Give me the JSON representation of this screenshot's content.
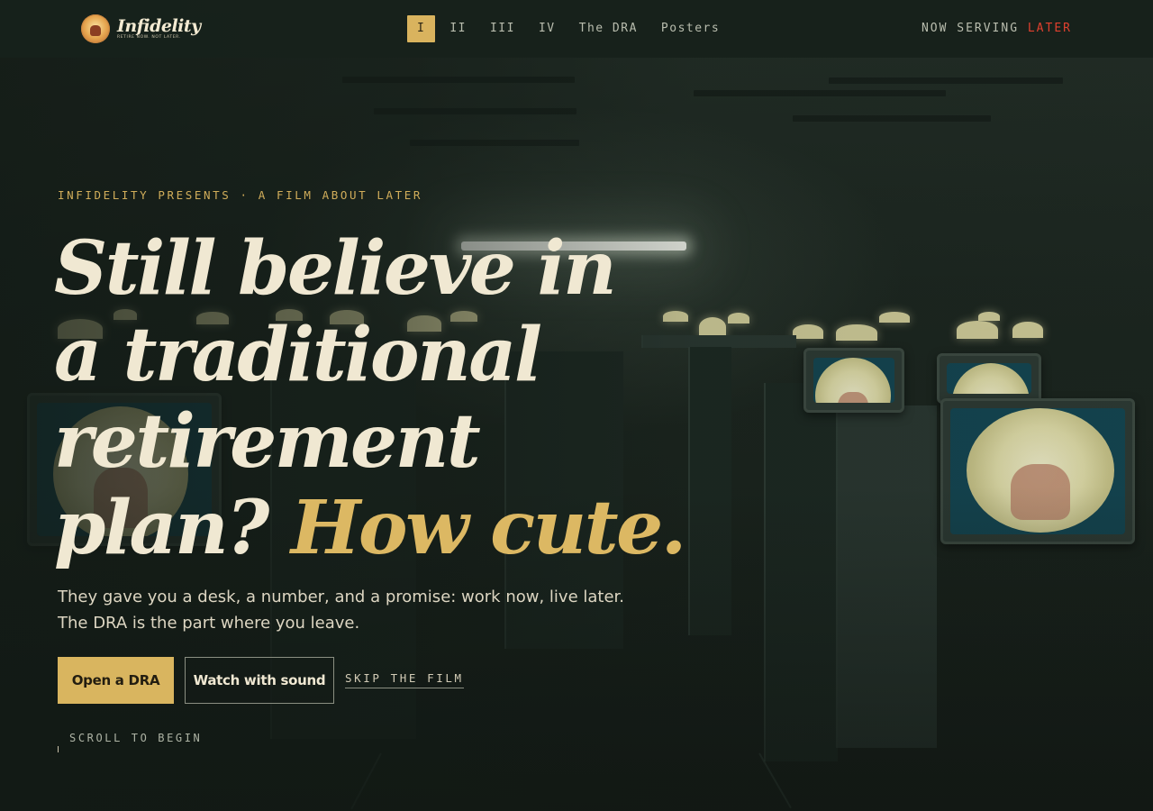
{
  "nav": {
    "brand": {
      "name": "Infidelity",
      "tagline": "RETIRE NOW. NOT LATER."
    },
    "links": [
      {
        "label": "I",
        "active": true
      },
      {
        "label": "II",
        "active": false
      },
      {
        "label": "III",
        "active": false
      },
      {
        "label": "IV",
        "active": false
      },
      {
        "label": "The DRA",
        "active": false
      },
      {
        "label": "Posters",
        "active": false
      }
    ],
    "status": {
      "prefix": "NOW SERVING",
      "value": "LATER"
    }
  },
  "hero": {
    "eyebrow": "INFIDELITY PRESENTS · A FILM ABOUT LATER",
    "headline": {
      "line1": "Still believe in",
      "line2": "a traditional",
      "line3": "retirement",
      "line4_plain": "plan?",
      "line4_accent": "How cute."
    },
    "lede": "They gave you a desk, a number, and a promise: work now, live later. The DRA is the part where you leave.",
    "primary_cta": "Open a DRA",
    "secondary_cta": "Watch with sound",
    "skip_link": "SKIP THE FILM",
    "scroll_cue": "SCROLL TO BEGIN"
  },
  "colors": {
    "background": "#172019",
    "accent_gold": "#d9b55f",
    "accent_red": "#e0402e",
    "text_cream": "#f0e8d2"
  },
  "icons": {
    "brand_logo": "fist-burst-logo-icon"
  }
}
